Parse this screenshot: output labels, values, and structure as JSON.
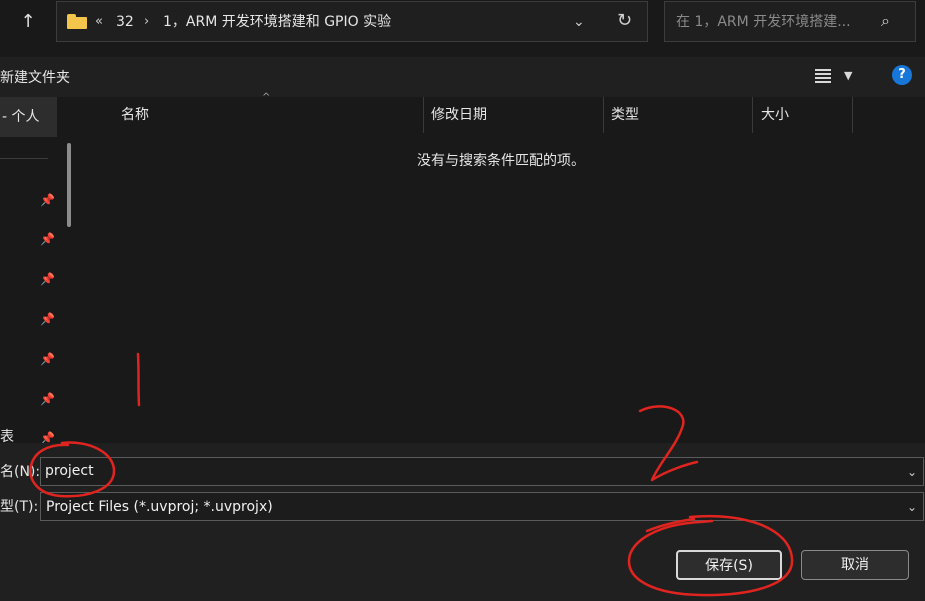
{
  "address_bar": {
    "overflow_chevron": "«",
    "crumbs": [
      "32",
      "1，ARM 开发环境搭建和 GPIO 实验"
    ],
    "separator": "›",
    "dropdown_glyph": "⌄",
    "refresh_glyph": "↻",
    "up_glyph": "↑"
  },
  "search": {
    "placeholder": "在 1，ARM 开发环境搭建...",
    "icon": "search-icon"
  },
  "toolbar": {
    "new_folder_label": "新建文件夹",
    "view_icon": "list-view-icon",
    "view_dropdown_glyph": "▼",
    "help_label": "?"
  },
  "nav_pane": {
    "selected_label": "- 个人",
    "bottom_label": "表",
    "pin_glyph": "📌",
    "pin_count": 7
  },
  "file_list": {
    "columns": [
      "名称",
      "修改日期",
      "类型",
      "大小"
    ],
    "sort_glyph": "^",
    "empty_message": "没有与搜索条件匹配的项。"
  },
  "save_form": {
    "filename_label": "名(N):",
    "filename_value": "project",
    "filetype_label": "型(T):",
    "filetype_value": "Project Files (*.uvproj; *.uvprojx)",
    "save_button": "保存(S)",
    "cancel_button": "取消"
  },
  "annotations": {
    "mark_1": "1",
    "mark_2": "2",
    "ink_color": "#e0241f"
  }
}
